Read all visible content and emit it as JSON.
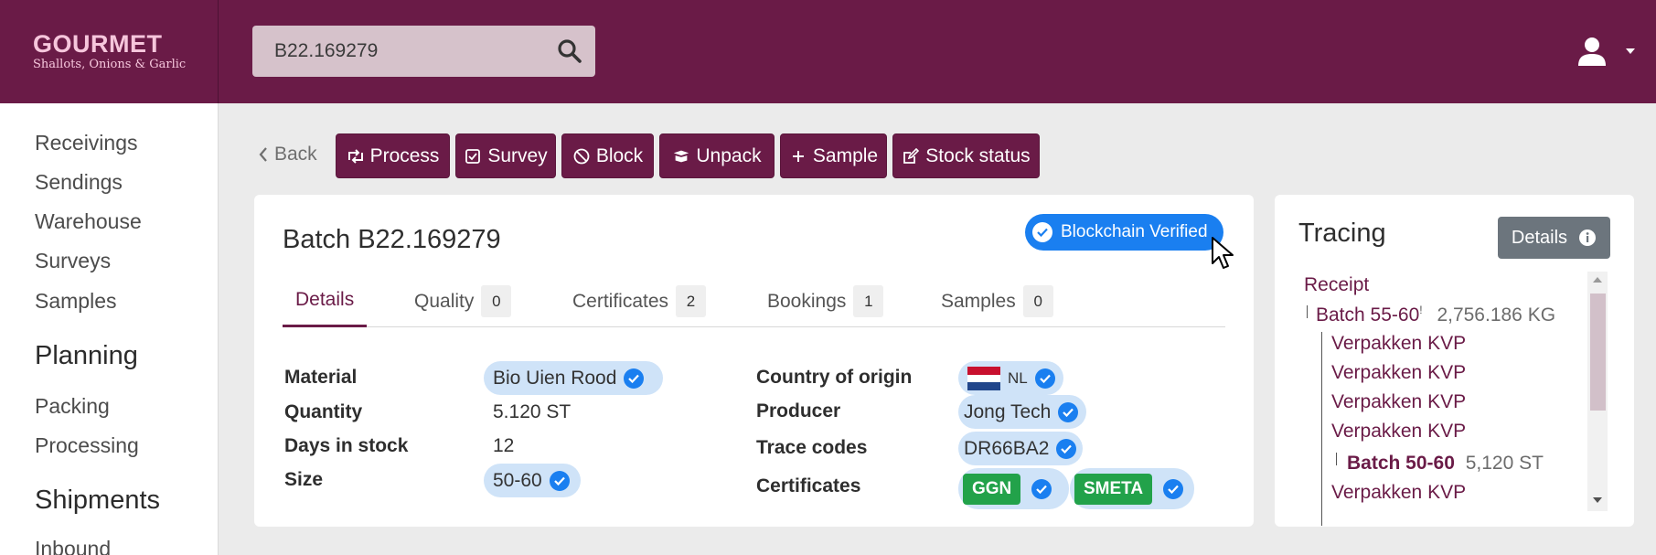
{
  "brand": {
    "name": "GOURMET",
    "tagline": "Shallots, Onions & Garlic"
  },
  "search": {
    "value": "B22.169279",
    "icon": "search-icon"
  },
  "user": {
    "icon": "user-icon",
    "dropdown_icon": "caret-down-icon"
  },
  "sidebar": {
    "items": [
      {
        "label": "Receivings"
      },
      {
        "label": "Sendings"
      },
      {
        "label": "Warehouse"
      },
      {
        "label": "Surveys"
      },
      {
        "label": "Samples"
      }
    ],
    "planning": {
      "heading": "Planning",
      "items": [
        {
          "label": "Packing"
        },
        {
          "label": "Processing"
        }
      ]
    },
    "shipments": {
      "heading": "Shipments",
      "items": [
        {
          "label": "Inbound"
        }
      ]
    }
  },
  "toolbar": {
    "back": "Back",
    "process": "Process",
    "survey": "Survey",
    "block": "Block",
    "unpack": "Unpack",
    "sample": "Sample",
    "stock_status": "Stock status"
  },
  "batch": {
    "title": "Batch B22.169279",
    "badge": "Blockchain Verified",
    "tabs": [
      {
        "label": "Details"
      },
      {
        "label": "Quality",
        "count": "0"
      },
      {
        "label": "Certificates",
        "count": "2"
      },
      {
        "label": "Bookings",
        "count": "1"
      },
      {
        "label": "Samples",
        "count": "0"
      }
    ],
    "details": {
      "material_label": "Material",
      "material": "Bio Uien Rood",
      "quantity_label": "Quantity",
      "quantity": "5.120 ST",
      "days_label": "Days in stock",
      "days": "12",
      "size_label": "Size",
      "size": "50-60",
      "country_label": "Country of origin",
      "country": "NL",
      "producer_label": "Producer",
      "producer": "Jong Tech",
      "trace_label": "Trace codes",
      "trace": "DR66BA2",
      "certs_label": "Certificates",
      "cert1": "GGN",
      "cert2": "SMETA"
    }
  },
  "tracing": {
    "title": "Tracing",
    "details_button": "Details",
    "root": "Receipt",
    "batch1": {
      "label": "Batch 55-60",
      "mark": "!",
      "meta": "2,756.186 KG"
    },
    "pack1": "Verpakken KVP",
    "pack2": "Verpakken KVP",
    "pack3": "Verpakken KVP",
    "pack4": "Verpakken KVP",
    "batch2": {
      "label": "Batch 50-60",
      "meta": "5,120 ST"
    },
    "pack5": "Verpakken KVP"
  },
  "colors": {
    "brand": "#6a1b47",
    "verified": "#1a7ff0",
    "cert": "#22a24a",
    "secondary": "#6c757d"
  }
}
